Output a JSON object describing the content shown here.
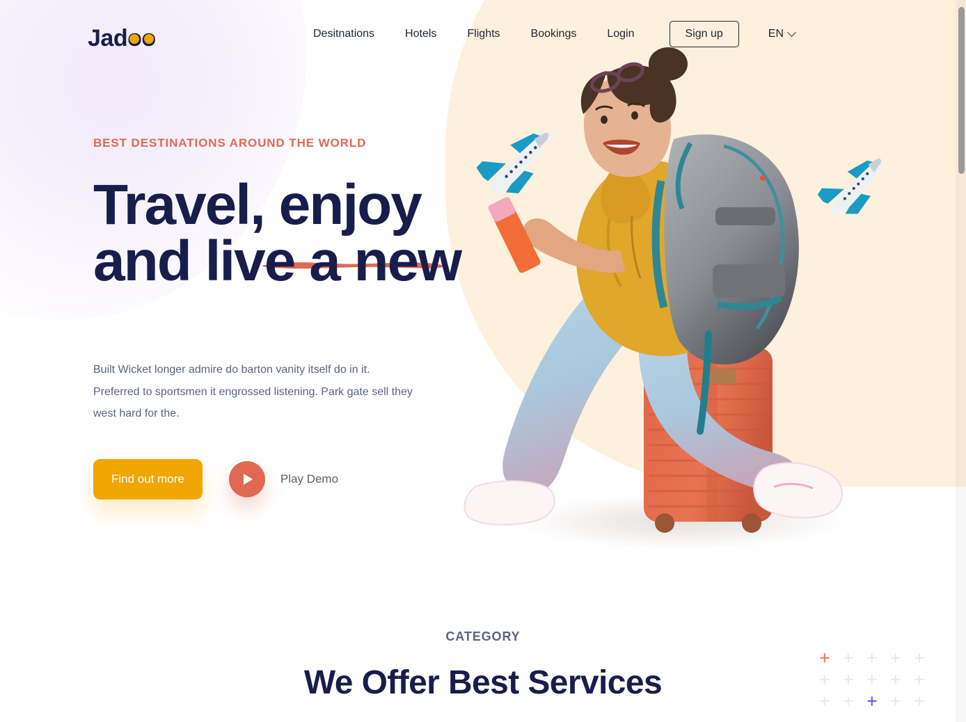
{
  "brand": {
    "name": "Jadoo",
    "name_prefix": "Jad",
    "name_o1": "o",
    "name_o2": "o",
    "accent_color": "#f1a501"
  },
  "nav": {
    "items": [
      {
        "label": "Desitnations",
        "name": "nav-destinations"
      },
      {
        "label": "Hotels",
        "name": "nav-hotels"
      },
      {
        "label": "Flights",
        "name": "nav-flights"
      },
      {
        "label": "Bookings",
        "name": "nav-bookings"
      },
      {
        "label": "Login",
        "name": "nav-login"
      }
    ],
    "signup_label": "Sign up",
    "language": "EN",
    "language_icon": "chevron-down-icon"
  },
  "hero": {
    "eyebrow": "BEST DESTINATIONS AROUND THE WORLD",
    "headline_line1": "Travel, enjoy",
    "headline_line2": "and live a new",
    "headline_color": "#181e4b",
    "brush_color": "#df6951",
    "description": "Built Wicket longer admire do barton vanity itself do in it. Preferred to sportsmen it engrossed listening. Park gate sell they west hard for the.",
    "primary_cta": "Find out more",
    "primary_cta_color": "#f1a501",
    "play_label": "Play Demo",
    "play_icon": "play-icon",
    "play_color": "#df6951",
    "image_alt": "traveler-woman-with-backpack-sitting-on-suitcase",
    "decor_plane_left": "airplane-icon",
    "decor_plane_right": "airplane-icon",
    "blob_color": "#fdf1dd"
  },
  "category": {
    "kicker": "CATEGORY",
    "title": "We Offer Best Services",
    "kicker_color": "#5e6282",
    "title_color": "#181e4b"
  },
  "decor": {
    "plus_grid": {
      "columns": 5,
      "rows": 3,
      "default_color": "#e8e8ee",
      "accents": [
        {
          "row": 0,
          "col": 0,
          "color": "#f4705a"
        },
        {
          "row": 2,
          "col": 2,
          "color": "#5d50f0"
        }
      ]
    }
  },
  "browser": {
    "scrollbar_position": "right",
    "scrollbar_thumb_color": "#9a9a9a"
  }
}
